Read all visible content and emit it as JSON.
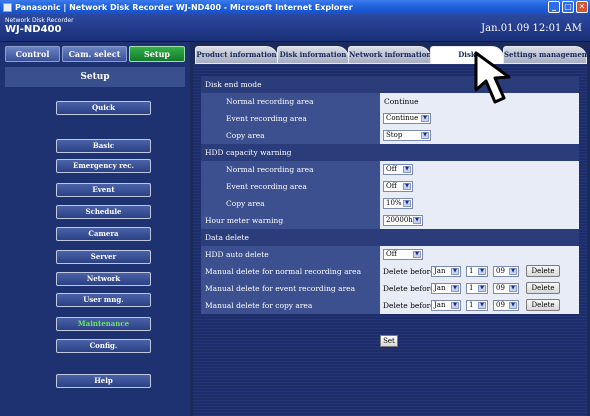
{
  "window": {
    "title": "Panasonic | Network Disk Recorder WJ-ND400 - Microsoft Internet Explorer",
    "minimize": "_",
    "maximize": "□",
    "close": "✕"
  },
  "header": {
    "product_line": "Network Disk Recorder",
    "model": "WJ-ND400",
    "datetime": "Jan.01.09 12:01 AM"
  },
  "toptabs": [
    {
      "label": "Control"
    },
    {
      "label": "Cam. select"
    },
    {
      "label": "Setup"
    }
  ],
  "sidebar": {
    "heading": "Setup",
    "items": [
      {
        "label": "Quick"
      },
      {
        "label": "Basic"
      },
      {
        "label": "Emergency rec."
      },
      {
        "label": "Event"
      },
      {
        "label": "Schedule"
      },
      {
        "label": "Camera"
      },
      {
        "label": "Server"
      },
      {
        "label": "Network"
      },
      {
        "label": "User mng."
      },
      {
        "label": "Maintenance"
      },
      {
        "label": "Config."
      },
      {
        "label": "Help"
      }
    ]
  },
  "tabs": [
    {
      "label": "Product information"
    },
    {
      "label": "Disk information"
    },
    {
      "label": "Network information"
    },
    {
      "label": "Disk"
    },
    {
      "label": "Settings management"
    }
  ],
  "form": {
    "disk_end_mode": "Disk end mode",
    "normal_area": "Normal recording area",
    "normal_area_value": "Continue",
    "event_area": "Event recording area",
    "event_area_value": "Continue",
    "copy_area": "Copy area",
    "copy_area_value": "Stop",
    "hdd_warning": "HDD capacity warning",
    "hdd_normal": "Normal recording area",
    "hdd_normal_value": "Off",
    "hdd_event": "Event recording area",
    "hdd_event_value": "Off",
    "hdd_copy": "Copy area",
    "hdd_copy_value": "10%",
    "hour_meter": "Hour meter warning",
    "hour_meter_value": "20000h",
    "data_delete": "Data delete",
    "hdd_auto_delete": "HDD auto delete",
    "hdd_auto_delete_value": "Off",
    "manual_normal": "Manual delete for normal recording area",
    "manual_event": "Manual delete for event recording area",
    "manual_copy": "Manual delete for copy area",
    "delete_before": "Delete before",
    "month": "Jan",
    "day": "1",
    "year": "09",
    "delete_label": "Delete",
    "set_label": "Set"
  },
  "colors": {
    "accent_green": "#33b04a",
    "panel_blue": "#3c4f8e",
    "header_blue": "#2d4aa0"
  }
}
